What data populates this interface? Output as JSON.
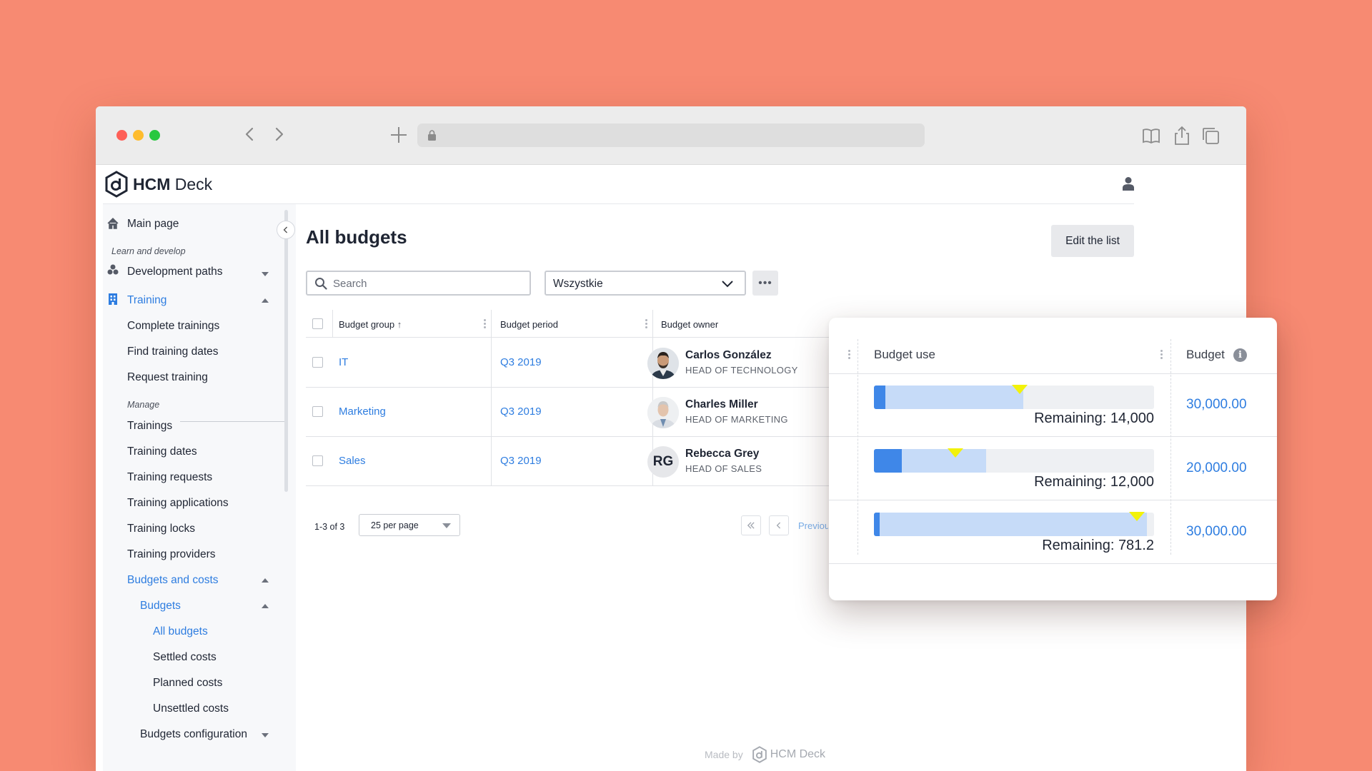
{
  "app": {
    "brand_strong": "HCM",
    "brand_light": " Deck"
  },
  "sidebar": {
    "main_page": "Main page",
    "section_learn": "Learn and develop",
    "development_paths": "Development paths",
    "training": "Training",
    "training_children": [
      "Complete trainings",
      "Find training dates",
      "Request training"
    ],
    "section_manage": "Manage",
    "manage_items": [
      "Trainings",
      "Training dates",
      "Training requests",
      "Training applications",
      "Training locks",
      "Training providers"
    ],
    "budgets_and_costs": "Budgets and costs",
    "budgets": "Budgets",
    "budget_items": [
      "All budgets",
      "Settled costs",
      "Planned costs",
      "Unsettled costs"
    ],
    "budgets_configuration": "Budgets configuration"
  },
  "main": {
    "title": "All budgets",
    "edit_button": "Edit the list",
    "search_placeholder": "Search",
    "filter_value": "Wszystkie",
    "more_label": "•••"
  },
  "table": {
    "headers": {
      "group": "Budget group",
      "period": "Budget period",
      "owner": "Budget owner"
    },
    "rows": [
      {
        "group": "IT",
        "period": "Q3 2019",
        "owner_name": "Carlos González",
        "owner_role": "HEAD OF TECHNOLOGY",
        "initials": ""
      },
      {
        "group": "Marketing",
        "period": "Q3 2019",
        "owner_name": "Charles Miller",
        "owner_role": "HEAD OF MARKETING",
        "initials": ""
      },
      {
        "group": "Sales",
        "period": "Q3 2019",
        "owner_name": "Rebecca Grey",
        "owner_role": "HEAD OF SALES",
        "initials": "RG"
      }
    ]
  },
  "pagination": {
    "count": "1-3 of 3",
    "per_page": "25 per page",
    "previous": "Previous"
  },
  "footer": {
    "made_by": "Made by",
    "brand": "HCM Deck"
  },
  "card": {
    "header_use": "Budget use",
    "header_budget": "Budget",
    "rows": [
      {
        "used_fraction": 0.533,
        "planned_fraction": 0.04,
        "marker_fraction": 0.52,
        "remaining": "Remaining: 14,000",
        "budget": "30,000.00"
      },
      {
        "used_fraction": 0.4,
        "planned_fraction": 0.1,
        "marker_fraction": 0.29,
        "remaining": "Remaining: 12,000",
        "budget": "20,000.00"
      },
      {
        "used_fraction": 0.974,
        "planned_fraction": 0.02,
        "marker_fraction": 0.94,
        "remaining": "Remaining: 781.2",
        "budget": "30,000.00"
      }
    ]
  },
  "colors": {
    "background": "#f78a72",
    "accent": "#2e7de0",
    "bar_used": "#c6dbf8",
    "bar_planned": "#3f87e8",
    "marker": "#f2f20a"
  }
}
